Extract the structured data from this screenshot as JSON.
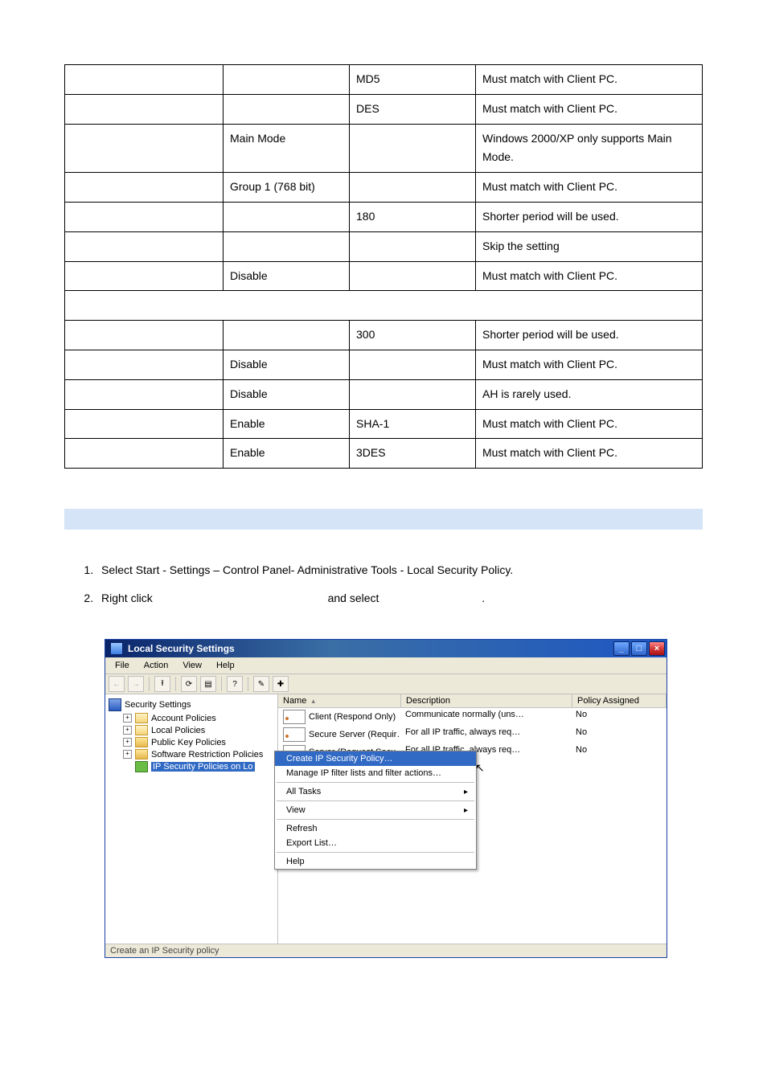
{
  "table": {
    "rows": [
      {
        "c1": "",
        "c2": "",
        "c3": "MD5",
        "c4": "Must match with Client PC."
      },
      {
        "c1": "",
        "c2": "",
        "c3": "DES",
        "c4": "Must match with Client PC."
      },
      {
        "c1": "",
        "c2": "Main Mode",
        "c3": "",
        "c4": "Windows 2000/XP only supports Main Mode."
      },
      {
        "c1": "",
        "c2": "Group 1 (768 bit)",
        "c3": "",
        "c4": "Must match with Client PC."
      },
      {
        "c1": "",
        "c2": "",
        "c3": "180",
        "c4": "Shorter period will be used."
      },
      {
        "c1": "",
        "c2": "",
        "c3": "",
        "c4": "Skip the setting"
      },
      {
        "c1": "",
        "c2": "Disable",
        "c3": "",
        "c4": "Must match with Client PC."
      },
      {
        "section": true
      },
      {
        "c1": "",
        "c2": "",
        "c3": "300",
        "c4": "Shorter period will be used."
      },
      {
        "c1": "",
        "c2": "Disable",
        "c3": "",
        "c4": "Must match with Client PC."
      },
      {
        "c1": "",
        "c2": "Disable",
        "c3": "",
        "c4": "AH is rarely used."
      },
      {
        "c1": "",
        "c2": "Enable",
        "c3": "SHA-1",
        "c4": "Must match with Client PC."
      },
      {
        "c1": "",
        "c2": "Enable",
        "c3": "3DES",
        "c4": "Must match with Client PC."
      }
    ]
  },
  "steps": {
    "s1": "Select Start - Settings – Control Panel- Administrative Tools - Local Security Policy.",
    "s2a": "Right click",
    "s2b": "and select",
    "s2c": "."
  },
  "win": {
    "title": "Local Security Settings",
    "menu": {
      "file": "File",
      "action": "Action",
      "view": "View",
      "help": "Help"
    },
    "tree": {
      "root": "Security Settings",
      "n1": "Account Policies",
      "n2": "Local Policies",
      "n3": "Public Key Policies",
      "n4": "Software Restriction Policies",
      "n5": "IP Security Policies on Lo"
    },
    "listHeader": {
      "name": "Name",
      "desc": "Description",
      "pol": "Policy Assigned"
    },
    "rows": [
      {
        "name": "Client (Respond Only)",
        "desc": "Communicate normally (uns…",
        "pol": "No"
      },
      {
        "name": "Secure Server (Requir…",
        "desc": "For all IP traffic, always req…",
        "pol": "No"
      },
      {
        "name": "Server (Request Secu…",
        "desc": "For all IP traffic, always req…",
        "pol": "No"
      }
    ],
    "ctx": {
      "create": "Create IP Security Policy…",
      "manage": "Manage IP filter lists and filter actions…",
      "allTasks": "All Tasks",
      "view": "View",
      "refresh": "Refresh",
      "export": "Export List…",
      "help": "Help"
    },
    "status": "Create an IP Security policy",
    "sortArrow": "▴"
  }
}
